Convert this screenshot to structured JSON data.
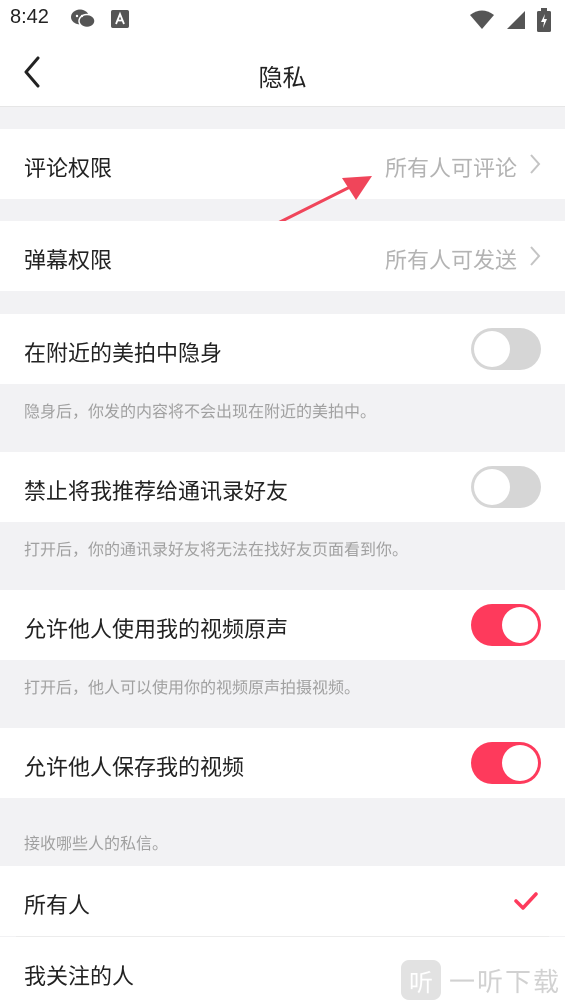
{
  "status_bar": {
    "time": "8:42",
    "left_icons": [
      "wechat-icon",
      "a-icon"
    ],
    "right_icons": [
      "wifi-icon",
      "signal-icon",
      "battery-icon"
    ]
  },
  "nav": {
    "title": "隐私",
    "back_icon": "chevron-left-icon"
  },
  "comment_permission": {
    "label": "评论权限",
    "value": "所有人可评论"
  },
  "danmaku_permission": {
    "label": "弹幕权限",
    "value": "所有人可发送"
  },
  "hide_nearby": {
    "label": "在附近的美拍中隐身",
    "enabled": false,
    "hint": "隐身后，你发的内容将不会出现在附近的美拍中。"
  },
  "no_contact_recommend": {
    "label": "禁止将我推荐给通讯录好友",
    "enabled": false,
    "hint": "打开后，你的通讯录好友将无法在找好友页面看到你。"
  },
  "allow_original_audio": {
    "label": "允许他人使用我的视频原声",
    "enabled": true,
    "hint": "打开后，他人可以使用你的视频原声拍摄视频。"
  },
  "allow_save_video": {
    "label": "允许他人保存我的视频",
    "enabled": true
  },
  "messages": {
    "hint": "接收哪些人的私信。",
    "options": [
      {
        "label": "所有人",
        "selected": true
      },
      {
        "label": "我关注的人",
        "selected": false
      }
    ]
  },
  "watermark": {
    "badge": "听",
    "text": "一听下载"
  },
  "colors": {
    "accent": "#fe3a5c",
    "toggle_off": "#d6d6d6",
    "annotation_arrow": "#f0455a"
  }
}
